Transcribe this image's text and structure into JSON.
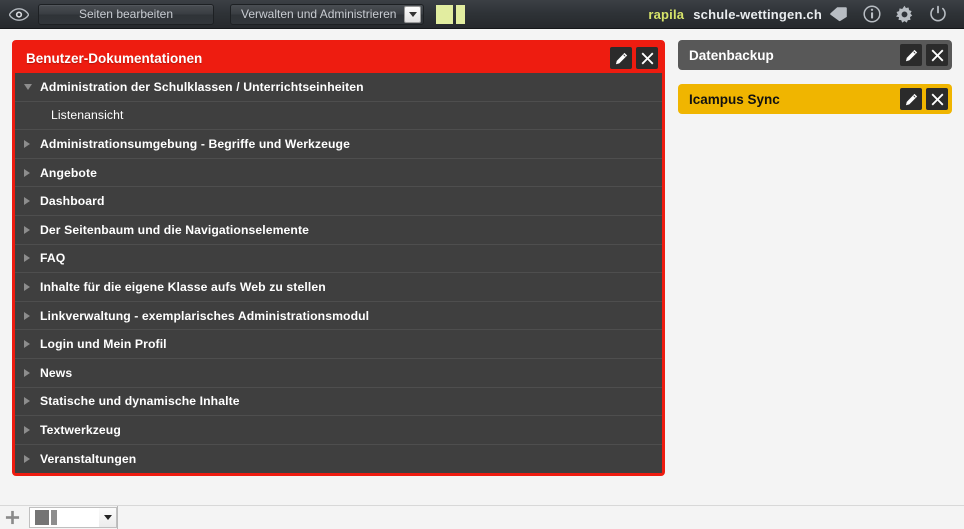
{
  "topbar": {
    "preview_icon": "eye-icon",
    "edit_pages_button": "Seiten bearbeiten",
    "manage_select_value": "Verwalten und Administrieren",
    "layout_indicator_name": "two-column-layout-indicator",
    "brand": "rapila",
    "site": "schule-wettingen.ch",
    "icons": [
      "tag-icon",
      "info-icon",
      "gear-icon",
      "power-icon"
    ]
  },
  "main_panel": {
    "title": "Benutzer-Dokumentationen",
    "accent_color": "#ee1c10",
    "edit_label": "edit-icon",
    "close_label": "close-icon",
    "items": [
      {
        "label": "Administration der Schulklassen / Unterrichtseinheiten",
        "state": "expanded",
        "level": 0
      },
      {
        "label": "Listenansicht",
        "state": "leaf",
        "level": 1
      },
      {
        "label": "Administrationsumgebung - Begriffe und Werkzeuge",
        "state": "collapsed",
        "level": 0
      },
      {
        "label": "Angebote",
        "state": "collapsed",
        "level": 0
      },
      {
        "label": "Dashboard",
        "state": "collapsed",
        "level": 0
      },
      {
        "label": "Der Seitenbaum und die Navigationselemente",
        "state": "collapsed",
        "level": 0
      },
      {
        "label": "FAQ",
        "state": "collapsed",
        "level": 0
      },
      {
        "label": "Inhalte für die eigene Klasse aufs Web zu stellen",
        "state": "collapsed",
        "level": 0
      },
      {
        "label": "Linkverwaltung - exemplarisches Administrationsmodul",
        "state": "collapsed",
        "level": 0
      },
      {
        "label": "Login und Mein Profil",
        "state": "collapsed",
        "level": 0
      },
      {
        "label": "News",
        "state": "collapsed",
        "level": 0
      },
      {
        "label": "Statische und dynamische Inhalte",
        "state": "collapsed",
        "level": 0
      },
      {
        "label": "Textwerkzeug",
        "state": "collapsed",
        "level": 0
      },
      {
        "label": "Veranstaltungen",
        "state": "collapsed",
        "level": 0
      }
    ]
  },
  "side_panels": [
    {
      "title": "Datenbackup",
      "color": "#585858",
      "style": "gray"
    },
    {
      "title": "Icampus Sync",
      "color": "#f0b500",
      "style": "gold"
    }
  ],
  "bottombar": {
    "add_icon": "plus-icon",
    "layout_select_value": "two-column-layout"
  }
}
